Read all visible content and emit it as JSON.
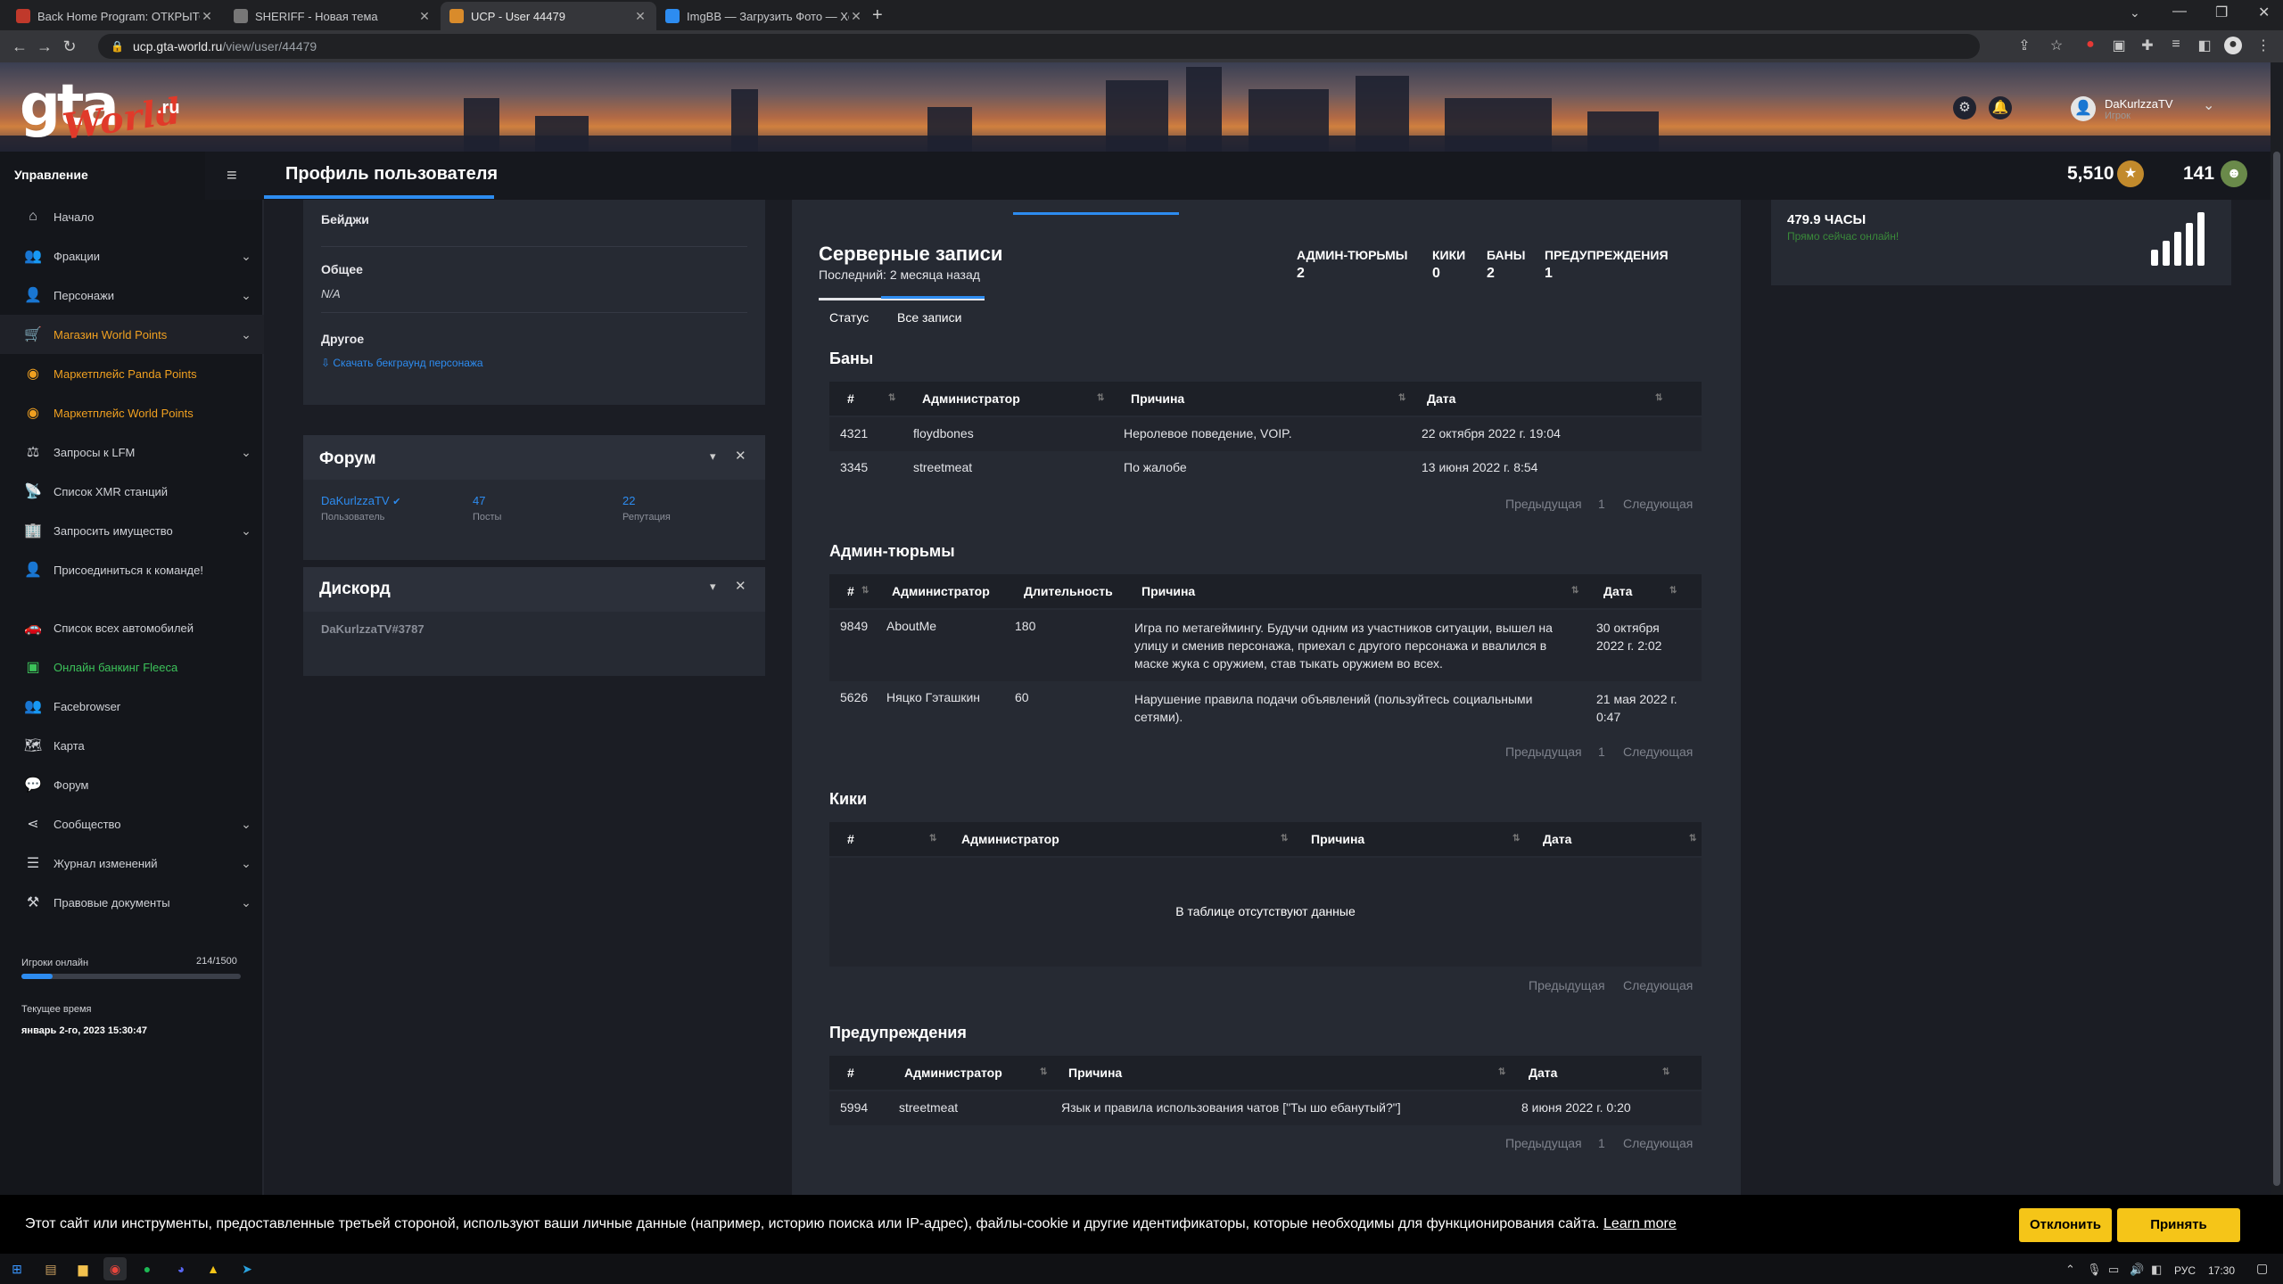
{
  "browser": {
    "tabs": [
      {
        "title": "Back Home Program: ОТКРЫТО"
      },
      {
        "title": "SHERIFF - Новая тема"
      },
      {
        "title": "UCP - User 44479"
      },
      {
        "title": "ImgBB — Загрузить Фото — Хо"
      }
    ],
    "url_host": "ucp.gta-world.ru",
    "url_path": "/view/user/44479"
  },
  "site": {
    "logo_main": "gta",
    "logo_script": "World",
    "logo_tld": ".ru",
    "user_name": "DaKurlzzaTV",
    "user_role": "Игрок"
  },
  "header": {
    "section_label": "Управление",
    "page_title": "Профиль пользователя",
    "points_value": "5,510",
    "second_value": "141"
  },
  "sidebar": {
    "items": [
      {
        "label": "Начало",
        "icon": "home-icon"
      },
      {
        "label": "Фракции",
        "icon": "users-icon"
      },
      {
        "label": "Персонажи",
        "icon": "user-icon"
      },
      {
        "label": "Магазин World Points",
        "icon": "cart-icon"
      },
      {
        "label": "Маркетплейс Panda Points",
        "icon": "coins-icon"
      },
      {
        "label": "Маркетплейс World Points",
        "icon": "coins-icon"
      },
      {
        "label": "Запросы к LFM",
        "icon": "scale-icon"
      },
      {
        "label": "Список XMR станций",
        "icon": "antenna-icon"
      },
      {
        "label": "Запросить имущество",
        "icon": "building-icon"
      },
      {
        "label": "Присоединиться к команде!",
        "icon": "user-plus-icon"
      },
      {
        "label": "Список всех автомобилей",
        "icon": "car-icon"
      },
      {
        "label": "Онлайн банкинг Fleeca",
        "icon": "bank-icon"
      },
      {
        "label": "Facebrowser",
        "icon": "users-icon"
      },
      {
        "label": "Карта",
        "icon": "map-icon"
      },
      {
        "label": "Форум",
        "icon": "comments-icon"
      },
      {
        "label": "Сообщество",
        "icon": "share-icon"
      },
      {
        "label": "Журнал изменений",
        "icon": "list-icon"
      },
      {
        "label": "Правовые документы",
        "icon": "gavel-icon"
      }
    ],
    "online_label": "Игроки онлайн",
    "online_count": "214/1500",
    "online_fraction": 0.143,
    "time_label": "Текущее время",
    "time_value": "январь 2-го, 2023 15:30:47"
  },
  "profile": {
    "badges_label": "Бейджи",
    "general_label": "Общее",
    "general_value": "N/A",
    "other_label": "Другое",
    "download_link": "Скачать бекграунд персонажа"
  },
  "forum": {
    "title": "Форум",
    "user": "DaKurlzzaTV",
    "user_caption": "Пользователь",
    "posts": "47",
    "posts_caption": "Посты",
    "rep": "22",
    "rep_caption": "Репутация"
  },
  "discord": {
    "title": "Дискорд",
    "tag": "DaKurlzzaTV#3787"
  },
  "records": {
    "title": "Серверные записи",
    "subtitle": "Последний: 2 месяца назад",
    "stats": [
      {
        "label": "АДМИН-ТЮРЬМЫ",
        "value": "2"
      },
      {
        "label": "КИКИ",
        "value": "0"
      },
      {
        "label": "БАНЫ",
        "value": "2"
      },
      {
        "label": "ПРЕДУПРЕЖДЕНИЯ",
        "value": "1"
      }
    ],
    "tabs": [
      "Статус",
      "Все записи"
    ],
    "prev": "Предыдущая",
    "next": "Следующая",
    "page": "1"
  },
  "bans": {
    "title": "Баны",
    "headers": [
      "#",
      "Администратор",
      "Причина",
      "Дата"
    ],
    "rows": [
      [
        "4321",
        "floydbones",
        "Неролевое поведение, VOIP.",
        "22 октября 2022 г. 19:04"
      ],
      [
        "3345",
        "streetmeat",
        "По жалобе",
        "13 июня 2022 г. 8:54"
      ]
    ]
  },
  "jails": {
    "title": "Админ-тюрьмы",
    "headers": [
      "#",
      "Администратор",
      "Длительность",
      "Причина",
      "Дата"
    ],
    "rows": [
      [
        "9849",
        "AboutMe",
        "180",
        "Игра по метагеймингу. Будучи одним из участников ситуации, вышел на улицу и сменив персонажа, приехал с другого персонажа и ввалился в маске жука с оружием, став тыкать оружием во всех.",
        "30 октября 2022 г. 2:02"
      ],
      [
        "5626",
        "Няцко Гэташкин",
        "60",
        "Нарушение правила подачи объявлений (пользуйтесь социальными сетями).",
        "21 мая 2022 г. 0:47"
      ]
    ]
  },
  "kicks": {
    "title": "Кики",
    "headers": [
      "#",
      "Администратор",
      "Причина",
      "Дата"
    ],
    "empty": "В таблице отсутствуют данные"
  },
  "warns": {
    "title": "Предупреждения",
    "headers": [
      "#",
      "Администратор",
      "Причина",
      "Дата"
    ],
    "rows": [
      [
        "5994",
        "streetmeat",
        "Язык и правила использования чатов [\"Ты шо ебанутый?\"]",
        "8 июня 2022 г. 0:20"
      ]
    ]
  },
  "hours": {
    "value": "479.9 ЧАСЫ",
    "status": "Прямо сейчас онлайн!"
  },
  "cookie": {
    "text": "Этот сайт или инструменты, предоставленные третьей стороной, используют ваши личные данные (например, историю поиска или IP-адрес), файлы-cookie и другие идентификаторы, которые необходимы для функционирования сайта.",
    "learn_more": "Learn more",
    "decline": "Отклонить",
    "accept": "Принять"
  },
  "taskbar": {
    "lang": "РУС",
    "time": "17:30"
  },
  "colors": {
    "accent": "#2d8cf0",
    "gold": "#f0a020",
    "green": "#3cc25a",
    "button": "#f5c518"
  }
}
